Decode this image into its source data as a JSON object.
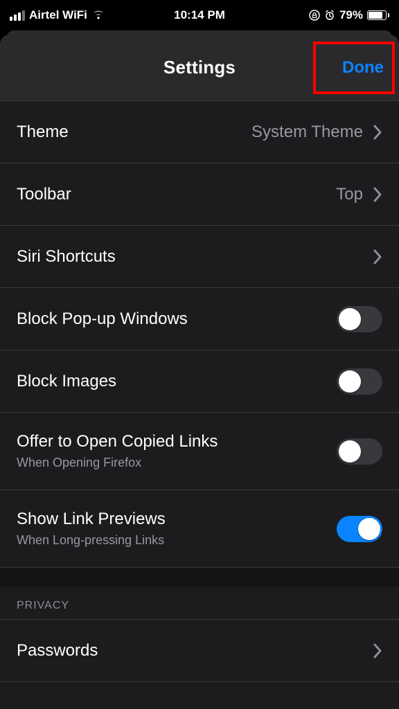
{
  "status": {
    "carrier": "Airtel WiFi",
    "time": "10:14 PM",
    "battery_pct": "79%"
  },
  "header": {
    "title": "Settings",
    "done": "Done"
  },
  "rows": {
    "theme": {
      "label": "Theme",
      "value": "System Theme"
    },
    "toolbar": {
      "label": "Toolbar",
      "value": "Top"
    },
    "siri": {
      "label": "Siri Shortcuts"
    },
    "popups": {
      "label": "Block Pop-up Windows"
    },
    "images": {
      "label": "Block Images"
    },
    "copied": {
      "label": "Offer to Open Copied Links",
      "sub": "When Opening Firefox"
    },
    "previews": {
      "label": "Show Link Previews",
      "sub": "When Long-pressing Links"
    },
    "passwords": {
      "label": "Passwords"
    }
  },
  "sections": {
    "privacy": "PRIVACY"
  },
  "toggles": {
    "popups": false,
    "images": false,
    "copied": false,
    "previews": true
  },
  "colors": {
    "accent": "#0a84ff",
    "highlight": "#ff0000"
  }
}
